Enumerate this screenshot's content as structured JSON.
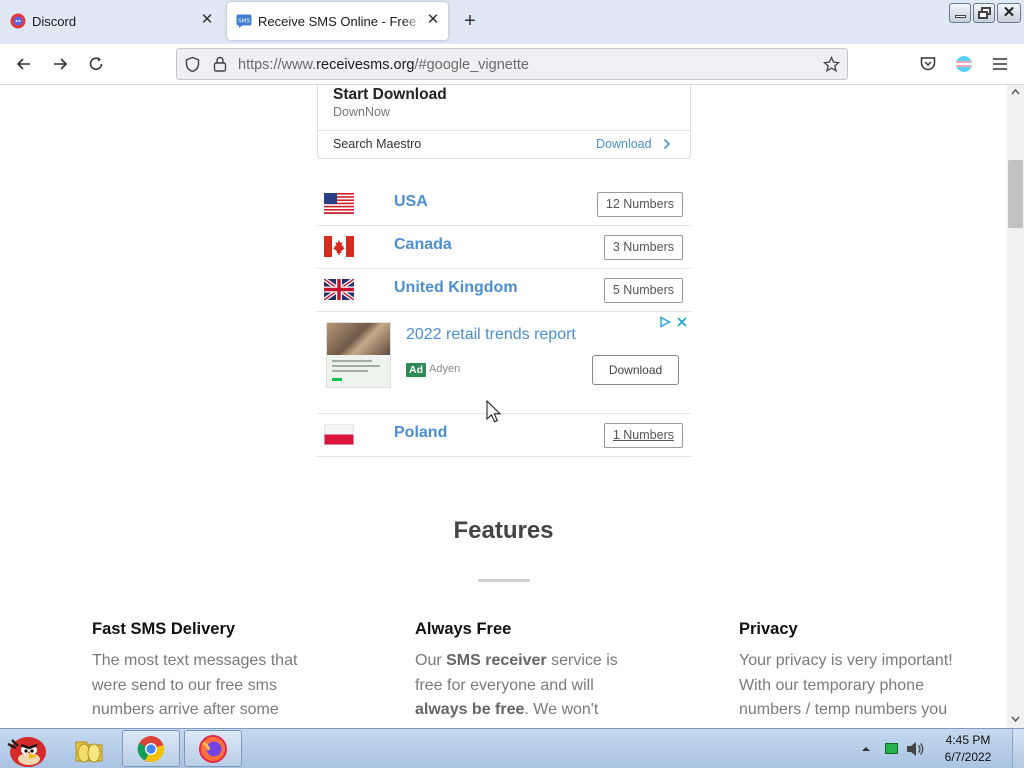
{
  "browser": {
    "tabs": [
      {
        "title": "Discord",
        "active": false
      },
      {
        "title": "Receive SMS Online - Free Temporary Phone Numbers",
        "active": true
      }
    ],
    "url": {
      "prefix": "https://www.",
      "domain": "receivesms.org",
      "suffix": "/#google_vignette"
    }
  },
  "ad_top": {
    "title": "Start Download",
    "subtitle": "DownNow",
    "footer_label": "Search Maestro",
    "footer_link": "Download"
  },
  "countries": [
    {
      "name": "USA",
      "numbers": "12 Numbers"
    },
    {
      "name": "Canada",
      "numbers": "3 Numbers"
    },
    {
      "name": "United Kingdom",
      "numbers": "5 Numbers"
    },
    {
      "name": "Poland",
      "numbers": "1 Numbers"
    }
  ],
  "ad_mid": {
    "title": "2022 retail trends report",
    "badge": "Ad",
    "advertiser": "Adyen",
    "button": "Download"
  },
  "features": {
    "heading": "Features",
    "items": [
      {
        "title": "Fast SMS Delivery",
        "text": "The most text messages that were send to our free sms numbers arrive after some"
      },
      {
        "title": "Always Free",
        "text_a": "Our ",
        "bold_a": "SMS receiver",
        "text_b": " service is free for everyone and will ",
        "bold_b": "always be free",
        "text_c": ". We won't"
      },
      {
        "title": "Privacy",
        "text": "Your privacy is very important! With our temporary phone numbers / temp numbers you"
      }
    ]
  },
  "taskbar": {
    "time": "4:45 PM",
    "date": "6/7/2022"
  },
  "colors": {
    "link": "#4a8fd0",
    "tab_strip": "#dfe8f4",
    "taskbar": "#b7cde8"
  }
}
